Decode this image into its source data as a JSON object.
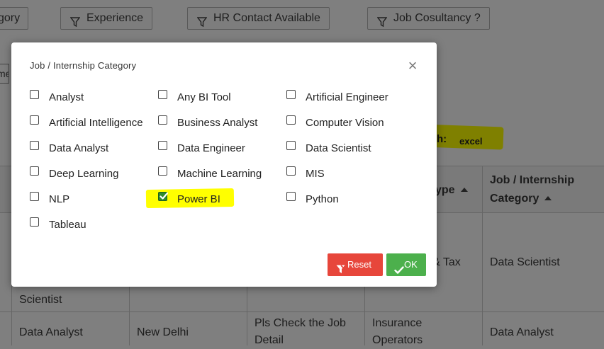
{
  "filters": {
    "category_partial": "gory",
    "experience": "Experience",
    "hr_contact": "HR Contact Available",
    "job_consultancy": "Job Cosultancy ?",
    "partial_second_row": "me"
  },
  "search": {
    "label": "h:",
    "value": "excel"
  },
  "table": {
    "header_type": "ype",
    "header_category_line1": "Job / Internship",
    "header_category_line2": "Category",
    "row1": {
      "col0": "Scientist",
      "col3": "& Tax",
      "col4": "Data Scientist"
    },
    "row2": {
      "col0": "Data Analyst",
      "col1": "New Delhi",
      "col2_line1": "Pls Check the Job",
      "col2_line2": "Detail",
      "col3_line1": "Insurance",
      "col3_line2": "Operators",
      "col4": "Data Analyst"
    }
  },
  "modal": {
    "title": "Job / Internship Category",
    "close": "×",
    "options": [
      {
        "label": "Analyst",
        "checked": false
      },
      {
        "label": "Any BI Tool",
        "checked": false
      },
      {
        "label": "Artificial Engineer",
        "checked": false
      },
      {
        "label": "Artificial Intelligence",
        "checked": false
      },
      {
        "label": "Business Analyst",
        "checked": false
      },
      {
        "label": "Computer Vision",
        "checked": false
      },
      {
        "label": "Data Analyst",
        "checked": false
      },
      {
        "label": "Data Engineer",
        "checked": false
      },
      {
        "label": "Data Scientist",
        "checked": false
      },
      {
        "label": "Deep Learning",
        "checked": false
      },
      {
        "label": "Machine Learning",
        "checked": false
      },
      {
        "label": "MIS",
        "checked": false
      },
      {
        "label": "NLP",
        "checked": false
      },
      {
        "label": "Power BI",
        "checked": true
      },
      {
        "label": "Python",
        "checked": false
      },
      {
        "label": "Tableau",
        "checked": false
      }
    ],
    "reset_label": "Reset",
    "ok_label": "OK"
  },
  "colors": {
    "reset": "#e7463b",
    "ok": "#4cb04c",
    "highlight": "#ffff00",
    "checked": "#2e8b2e"
  }
}
